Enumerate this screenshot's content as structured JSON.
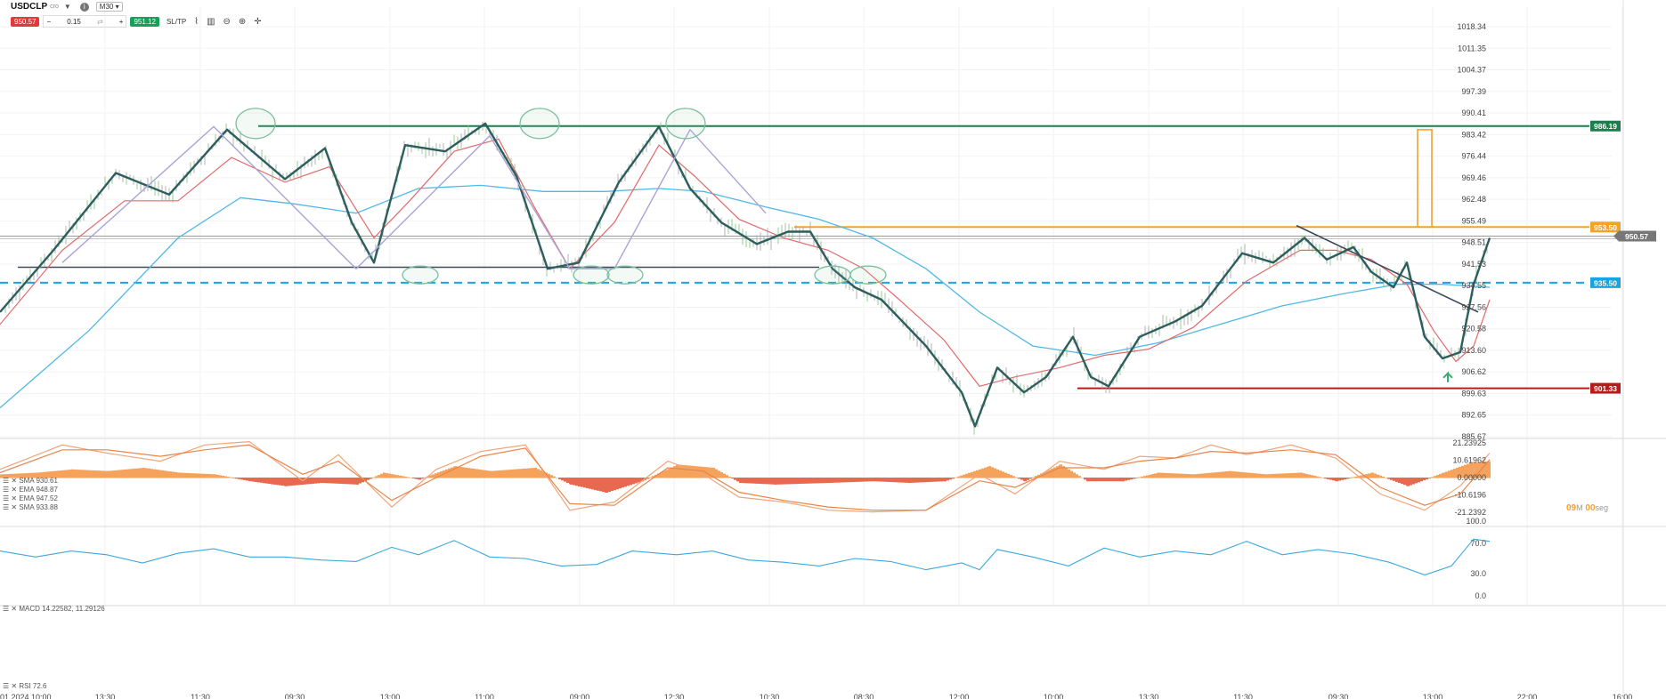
{
  "toolbar": {
    "symbol": "USDCLP",
    "symbol_suffix": "cro",
    "timeframe": "M30",
    "sell_price": "950.57",
    "quantity": "0.15",
    "buy_price": "951.12",
    "sltp_label": "SL/TP"
  },
  "main_legend": [
    "SMA 930.61",
    "EMA 948.87",
    "EMA 947.52",
    "SMA 933.88"
  ],
  "macd_legend": "MACD 14.22582, 11.29126",
  "rsi_legend": "RSI 72.6",
  "timer": {
    "value_m": "09",
    "unit_m": "M",
    "value_s": "00",
    "unit_s": "seg"
  },
  "colors": {
    "price_line": "#2d5d5d",
    "ema_fast": "#e26a6a",
    "sma_slow": "#4fb9e6",
    "green_level": "#1e7d4d",
    "orange_level": "#f3a32b",
    "blue_level": "#1aa3df",
    "red_level": "#b71c1c",
    "macd_pos": "#f5a35c",
    "macd_neg": "#e66a4f",
    "rsi_line": "#3aa8dd"
  },
  "chart_data": {
    "type": "line",
    "title": "USDCLP",
    "y_axis_ticks": [
      "1018.34",
      "1011.35",
      "1004.37",
      "997.39",
      "990.41",
      "983.42",
      "976.44",
      "969.46",
      "962.48",
      "955.49",
      "948.51",
      "941.53",
      "934.55",
      "927.56",
      "920.58",
      "913.60",
      "906.62",
      "899.63",
      "892.65",
      "885.67"
    ],
    "ylim": [
      885.67,
      1018.34
    ],
    "x_axis_labels": [
      "13:30",
      "11:30",
      "09:30",
      "13:00",
      "11:00",
      "09:00",
      "12:30",
      "10:30",
      "08:30",
      "12:00",
      "10:00",
      "13:30",
      "11:30",
      "09:30",
      "13:00",
      "22:00",
      "16:00"
    ],
    "x_axis_start_label": "01.2024 10:00",
    "price_labels": [
      {
        "label": "986.19",
        "value": 986.19,
        "color": "#1e7d4d"
      },
      {
        "label": "953.50",
        "value": 953.5,
        "color": "#f3a32b"
      },
      {
        "label": "950.57",
        "value": 950.57,
        "color": "#777777"
      },
      {
        "label": "935.50",
        "value": 935.5,
        "color": "#1aa3df"
      },
      {
        "label": "901.33",
        "value": 901.33,
        "color": "#b71c1c"
      }
    ],
    "price_series": [
      [
        0,
        926
      ],
      [
        60,
        946
      ],
      [
        130,
        971
      ],
      [
        190,
        964
      ],
      [
        255,
        985
      ],
      [
        320,
        969
      ],
      [
        365,
        979
      ],
      [
        395,
        955
      ],
      [
        420,
        942
      ],
      [
        455,
        980
      ],
      [
        500,
        978
      ],
      [
        545,
        987
      ],
      [
        580,
        970
      ],
      [
        615,
        940
      ],
      [
        650,
        942
      ],
      [
        695,
        968
      ],
      [
        740,
        986
      ],
      [
        775,
        966
      ],
      [
        810,
        955
      ],
      [
        850,
        948
      ],
      [
        885,
        952
      ],
      [
        910,
        952
      ],
      [
        935,
        940
      ],
      [
        960,
        934
      ],
      [
        990,
        930
      ],
      [
        1040,
        915
      ],
      [
        1080,
        900
      ],
      [
        1095,
        889
      ],
      [
        1120,
        908
      ],
      [
        1150,
        900
      ],
      [
        1175,
        905
      ],
      [
        1205,
        918
      ],
      [
        1225,
        905
      ],
      [
        1245,
        902
      ],
      [
        1280,
        918
      ],
      [
        1320,
        923
      ],
      [
        1350,
        928
      ],
      [
        1395,
        945
      ],
      [
        1430,
        942
      ],
      [
        1465,
        950
      ],
      [
        1490,
        943
      ],
      [
        1520,
        947
      ],
      [
        1540,
        939
      ],
      [
        1565,
        934
      ],
      [
        1580,
        942
      ],
      [
        1600,
        918
      ],
      [
        1620,
        911
      ],
      [
        1640,
        913
      ],
      [
        1655,
        935
      ],
      [
        1673,
        950
      ]
    ],
    "ema_series": [
      [
        0,
        922
      ],
      [
        70,
        946
      ],
      [
        140,
        962
      ],
      [
        200,
        962
      ],
      [
        260,
        976
      ],
      [
        320,
        968
      ],
      [
        370,
        973
      ],
      [
        420,
        950
      ],
      [
        460,
        962
      ],
      [
        510,
        978
      ],
      [
        560,
        982
      ],
      [
        600,
        960
      ],
      [
        640,
        940
      ],
      [
        690,
        955
      ],
      [
        740,
        980
      ],
      [
        780,
        970
      ],
      [
        830,
        956
      ],
      [
        880,
        950
      ],
      [
        930,
        946
      ],
      [
        970,
        940
      ],
      [
        1010,
        930
      ],
      [
        1060,
        917
      ],
      [
        1100,
        902
      ],
      [
        1140,
        905
      ],
      [
        1190,
        908
      ],
      [
        1240,
        912
      ],
      [
        1290,
        914
      ],
      [
        1340,
        921
      ],
      [
        1400,
        936
      ],
      [
        1460,
        946
      ],
      [
        1500,
        946
      ],
      [
        1540,
        943
      ],
      [
        1580,
        935
      ],
      [
        1610,
        920
      ],
      [
        1635,
        910
      ],
      [
        1655,
        915
      ],
      [
        1673,
        930
      ]
    ],
    "sma_series": [
      [
        0,
        895
      ],
      [
        100,
        920
      ],
      [
        200,
        950
      ],
      [
        270,
        963
      ],
      [
        330,
        961
      ],
      [
        400,
        958
      ],
      [
        470,
        966
      ],
      [
        540,
        967
      ],
      [
        610,
        965
      ],
      [
        680,
        965
      ],
      [
        740,
        966
      ],
      [
        790,
        965
      ],
      [
        860,
        960
      ],
      [
        920,
        956
      ],
      [
        980,
        950
      ],
      [
        1040,
        940
      ],
      [
        1100,
        926
      ],
      [
        1160,
        915
      ],
      [
        1230,
        912
      ],
      [
        1300,
        916
      ],
      [
        1370,
        922
      ],
      [
        1440,
        928
      ],
      [
        1510,
        932
      ],
      [
        1570,
        935
      ],
      [
        1620,
        935
      ],
      [
        1673,
        934
      ]
    ],
    "zigzag_series": [
      [
        70,
        942
      ],
      [
        240,
        986
      ],
      [
        400,
        940
      ],
      [
        550,
        983
      ],
      [
        640,
        940
      ],
      [
        690,
        940
      ],
      [
        775,
        985
      ],
      [
        860,
        958
      ]
    ],
    "neckline_series": [
      [
        20,
        940.5
      ],
      [
        920,
        940.5
      ]
    ],
    "trendline_series": [
      [
        1456,
        954
      ],
      [
        1660,
        926
      ]
    ],
    "target_rect": {
      "x_start": 1592,
      "x_end": 1608,
      "y_top": 985,
      "y_bottom": 953.5
    },
    "circle_marks": [
      [
        287,
        987
      ],
      [
        472,
        938
      ],
      [
        606,
        987
      ],
      [
        664,
        938
      ],
      [
        702,
        938
      ],
      [
        770,
        987
      ],
      [
        935,
        938
      ],
      [
        975,
        938
      ]
    ],
    "macd": {
      "ylim": [
        -21.2392,
        21.23925
      ],
      "ticks": [
        "21.23925",
        "10.61962",
        "0.00000",
        "-10.6196",
        "-21.2392"
      ],
      "bars": [
        [
          0,
          2
        ],
        [
          40,
          3
        ],
        [
          80,
          5
        ],
        [
          120,
          4
        ],
        [
          160,
          6
        ],
        [
          200,
          3
        ],
        [
          240,
          2
        ],
        [
          280,
          -2
        ],
        [
          320,
          -5
        ],
        [
          360,
          -3
        ],
        [
          400,
          -4
        ],
        [
          430,
          3
        ],
        [
          470,
          -1
        ],
        [
          510,
          7
        ],
        [
          550,
          4
        ],
        [
          600,
          6
        ],
        [
          640,
          -4
        ],
        [
          680,
          -9
        ],
        [
          720,
          -2
        ],
        [
          760,
          8
        ],
        [
          800,
          6
        ],
        [
          830,
          -3
        ],
        [
          870,
          -4
        ],
        [
          930,
          -3
        ],
        [
          980,
          -2
        ],
        [
          1020,
          -3
        ],
        [
          1060,
          -2
        ],
        [
          1110,
          7
        ],
        [
          1150,
          -2
        ],
        [
          1190,
          8
        ],
        [
          1220,
          -2
        ],
        [
          1260,
          -2
        ],
        [
          1300,
          3
        ],
        [
          1340,
          2
        ],
        [
          1380,
          4
        ],
        [
          1420,
          2
        ],
        [
          1460,
          3
        ],
        [
          1500,
          -2
        ],
        [
          1540,
          3
        ],
        [
          1580,
          -5
        ],
        [
          1620,
          3
        ],
        [
          1650,
          9
        ],
        [
          1673,
          10
        ]
      ],
      "line1": [
        [
          0,
          5
        ],
        [
          70,
          20
        ],
        [
          120,
          15
        ],
        [
          180,
          10
        ],
        [
          230,
          20
        ],
        [
          280,
          22
        ],
        [
          340,
          -2
        ],
        [
          380,
          14
        ],
        [
          440,
          -18
        ],
        [
          490,
          5
        ],
        [
          540,
          16
        ],
        [
          590,
          20
        ],
        [
          640,
          -20
        ],
        [
          690,
          -15
        ],
        [
          750,
          10
        ],
        [
          790,
          2
        ],
        [
          830,
          -12
        ],
        [
          880,
          -15
        ],
        [
          930,
          -20
        ],
        [
          980,
          -21
        ],
        [
          1040,
          -20
        ],
        [
          1100,
          2
        ],
        [
          1140,
          -10
        ],
        [
          1190,
          10
        ],
        [
          1240,
          5
        ],
        [
          1280,
          13
        ],
        [
          1320,
          12
        ],
        [
          1360,
          20
        ],
        [
          1400,
          14
        ],
        [
          1450,
          20
        ],
        [
          1500,
          12
        ],
        [
          1550,
          -10
        ],
        [
          1600,
          -20
        ],
        [
          1640,
          -5
        ],
        [
          1673,
          15
        ]
      ],
      "line2": [
        [
          0,
          3
        ],
        [
          70,
          17
        ],
        [
          120,
          17
        ],
        [
          180,
          13
        ],
        [
          230,
          17
        ],
        [
          280,
          20
        ],
        [
          340,
          2
        ],
        [
          380,
          10
        ],
        [
          440,
          -14
        ],
        [
          490,
          0
        ],
        [
          540,
          13
        ],
        [
          590,
          18
        ],
        [
          640,
          -16
        ],
        [
          690,
          -17
        ],
        [
          750,
          6
        ],
        [
          790,
          4
        ],
        [
          830,
          -9
        ],
        [
          880,
          -14
        ],
        [
          930,
          -18
        ],
        [
          980,
          -20
        ],
        [
          1040,
          -20
        ],
        [
          1100,
          -2
        ],
        [
          1140,
          -6
        ],
        [
          1190,
          6
        ],
        [
          1240,
          6
        ],
        [
          1280,
          10
        ],
        [
          1320,
          12
        ],
        [
          1360,
          16
        ],
        [
          1400,
          15
        ],
        [
          1450,
          17
        ],
        [
          1500,
          14
        ],
        [
          1550,
          -6
        ],
        [
          1600,
          -17
        ],
        [
          1640,
          -10
        ],
        [
          1673,
          11
        ]
      ]
    },
    "rsi": {
      "ylim": [
        0,
        100
      ],
      "ticks": [
        "100.0",
        "70.0",
        "30.0",
        "0.0"
      ],
      "series": [
        [
          0,
          60
        ],
        [
          40,
          52
        ],
        [
          80,
          60
        ],
        [
          120,
          55
        ],
        [
          160,
          44
        ],
        [
          200,
          57
        ],
        [
          240,
          63
        ],
        [
          280,
          52
        ],
        [
          320,
          52
        ],
        [
          360,
          48
        ],
        [
          400,
          46
        ],
        [
          440,
          65
        ],
        [
          470,
          55
        ],
        [
          510,
          74
        ],
        [
          550,
          52
        ],
        [
          590,
          50
        ],
        [
          630,
          40
        ],
        [
          670,
          42
        ],
        [
          710,
          60
        ],
        [
          760,
          55
        ],
        [
          800,
          60
        ],
        [
          840,
          48
        ],
        [
          880,
          45
        ],
        [
          920,
          40
        ],
        [
          960,
          50
        ],
        [
          1000,
          46
        ],
        [
          1040,
          35
        ],
        [
          1080,
          44
        ],
        [
          1100,
          35
        ],
        [
          1120,
          62
        ],
        [
          1160,
          52
        ],
        [
          1200,
          40
        ],
        [
          1240,
          64
        ],
        [
          1280,
          52
        ],
        [
          1320,
          60
        ],
        [
          1360,
          55
        ],
        [
          1400,
          73
        ],
        [
          1440,
          55
        ],
        [
          1480,
          62
        ],
        [
          1520,
          56
        ],
        [
          1560,
          45
        ],
        [
          1600,
          28
        ],
        [
          1630,
          40
        ],
        [
          1655,
          76
        ],
        [
          1673,
          73
        ]
      ]
    }
  }
}
